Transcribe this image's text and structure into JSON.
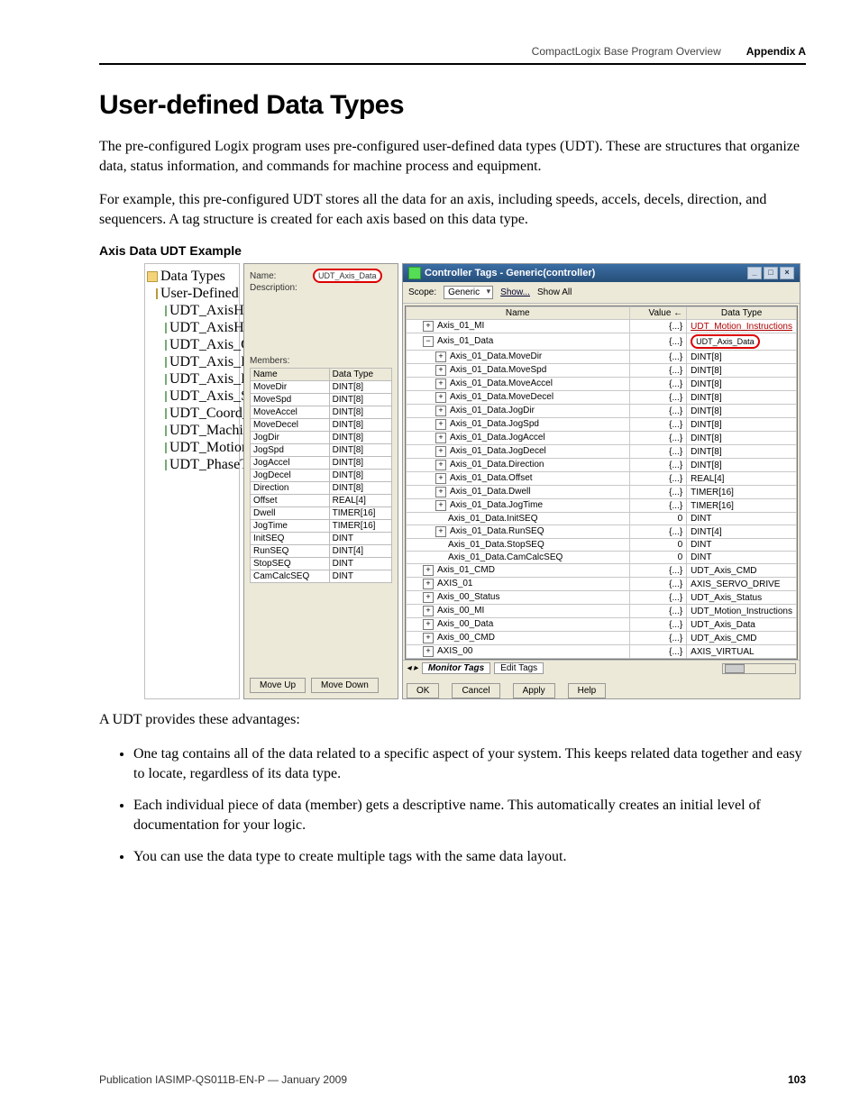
{
  "header": {
    "doc_section": "CompactLogix Base Program Overview",
    "appendix": "Appendix A"
  },
  "title": "User-defined Data Types",
  "para1": "The pre-configured Logix program uses pre-configured user-defined data types (UDT). These are structures that organize data, status information, and commands for machine process and equipment.",
  "para2": "For example, this pre-configured UDT stores all the data for an axis, including speeds, accels, decels, direction, and sequencers. A tag structure is created for each axis based on this data type.",
  "example_title": "Axis Data UDT Example",
  "tree": {
    "root": "Data Types",
    "folder": "User-Defined",
    "items": [
      "UDT_AxisHistory_CTRL",
      "UDT_AxisHistory_DLM",
      "UDT_Axis_CMD",
      "UDT_Axis_Data",
      "UDT_Axis_Hc",
      "UDT_Axis_St",
      "UDT_Coord_I",
      "UDT_Machine",
      "UDT_Motion_",
      "UDT_PhaseTi"
    ]
  },
  "def_dialog": {
    "name_label": "Name:",
    "name_value": "UDT_Axis_Data",
    "desc_label": "Description:",
    "members_label": "Members:",
    "cols": {
      "name": "Name",
      "type": "Data Type"
    },
    "rows": [
      {
        "name": "MoveDir",
        "type": "DINT[8]"
      },
      {
        "name": "MoveSpd",
        "type": "DINT[8]"
      },
      {
        "name": "MoveAccel",
        "type": "DINT[8]"
      },
      {
        "name": "MoveDecel",
        "type": "DINT[8]"
      },
      {
        "name": "JogDir",
        "type": "DINT[8]"
      },
      {
        "name": "JogSpd",
        "type": "DINT[8]"
      },
      {
        "name": "JogAccel",
        "type": "DINT[8]"
      },
      {
        "name": "JogDecel",
        "type": "DINT[8]"
      },
      {
        "name": "Direction",
        "type": "DINT[8]"
      },
      {
        "name": "Offset",
        "type": "REAL[4]"
      },
      {
        "name": "Dwell",
        "type": "TIMER[16]"
      },
      {
        "name": "JogTime",
        "type": "TIMER[16]"
      },
      {
        "name": "InitSEQ",
        "type": "DINT"
      },
      {
        "name": "RunSEQ",
        "type": "DINT[4]"
      },
      {
        "name": "StopSEQ",
        "type": "DINT"
      },
      {
        "name": "CamCalcSEQ",
        "type": "DINT"
      }
    ],
    "btn_moveup": "Move Up",
    "btn_movedown": "Move Down"
  },
  "tags_window": {
    "title": "Controller Tags - Generic(controller)",
    "scope_label": "Scope:",
    "scope_value": "Generic",
    "show_link": "Show...",
    "show_all": "Show All",
    "cols": {
      "name": "Name",
      "value": "Value",
      "type": "Data Type"
    },
    "rows": [
      {
        "ind": 1,
        "exp": "+",
        "name": "Axis_01_MI",
        "value": "{...}",
        "type": "UDT_Motion_Instructions",
        "hl": true
      },
      {
        "ind": 1,
        "exp": "−",
        "name": "Axis_01_Data",
        "value": "{...}",
        "type": "UDT_Axis_Data",
        "hl_type": true
      },
      {
        "ind": 2,
        "exp": "+",
        "name": "Axis_01_Data.MoveDir",
        "value": "{...}",
        "type": "DINT[8]"
      },
      {
        "ind": 2,
        "exp": "+",
        "name": "Axis_01_Data.MoveSpd",
        "value": "{...}",
        "type": "DINT[8]"
      },
      {
        "ind": 2,
        "exp": "+",
        "name": "Axis_01_Data.MoveAccel",
        "value": "{...}",
        "type": "DINT[8]"
      },
      {
        "ind": 2,
        "exp": "+",
        "name": "Axis_01_Data.MoveDecel",
        "value": "{...}",
        "type": "DINT[8]"
      },
      {
        "ind": 2,
        "exp": "+",
        "name": "Axis_01_Data.JogDir",
        "value": "{...}",
        "type": "DINT[8]"
      },
      {
        "ind": 2,
        "exp": "+",
        "name": "Axis_01_Data.JogSpd",
        "value": "{...}",
        "type": "DINT[8]"
      },
      {
        "ind": 2,
        "exp": "+",
        "name": "Axis_01_Data.JogAccel",
        "value": "{...}",
        "type": "DINT[8]"
      },
      {
        "ind": 2,
        "exp": "+",
        "name": "Axis_01_Data.JogDecel",
        "value": "{...}",
        "type": "DINT[8]"
      },
      {
        "ind": 2,
        "exp": "+",
        "name": "Axis_01_Data.Direction",
        "value": "{...}",
        "type": "DINT[8]"
      },
      {
        "ind": 2,
        "exp": "+",
        "name": "Axis_01_Data.Offset",
        "value": "{...}",
        "type": "REAL[4]"
      },
      {
        "ind": 2,
        "exp": "+",
        "name": "Axis_01_Data.Dwell",
        "value": "{...}",
        "type": "TIMER[16]"
      },
      {
        "ind": 2,
        "exp": "+",
        "name": "Axis_01_Data.JogTime",
        "value": "{...}",
        "type": "TIMER[16]"
      },
      {
        "ind": 2,
        "exp": "",
        "name": "Axis_01_Data.InitSEQ",
        "value": "0",
        "type": "DINT"
      },
      {
        "ind": 2,
        "exp": "+",
        "name": "Axis_01_Data.RunSEQ",
        "value": "{...}",
        "type": "DINT[4]"
      },
      {
        "ind": 2,
        "exp": "",
        "name": "Axis_01_Data.StopSEQ",
        "value": "0",
        "type": "DINT"
      },
      {
        "ind": 2,
        "exp": "",
        "name": "Axis_01_Data.CamCalcSEQ",
        "value": "0",
        "type": "DINT"
      },
      {
        "ind": 1,
        "exp": "+",
        "name": "Axis_01_CMD",
        "value": "{...}",
        "type": "UDT_Axis_CMD"
      },
      {
        "ind": 1,
        "exp": "+",
        "name": "AXIS_01",
        "value": "{...}",
        "type": "AXIS_SERVO_DRIVE"
      },
      {
        "ind": 1,
        "exp": "+",
        "name": "Axis_00_Status",
        "value": "{...}",
        "type": "UDT_Axis_Status"
      },
      {
        "ind": 1,
        "exp": "+",
        "name": "Axis_00_MI",
        "value": "{...}",
        "type": "UDT_Motion_Instructions"
      },
      {
        "ind": 1,
        "exp": "+",
        "name": "Axis_00_Data",
        "value": "{...}",
        "type": "UDT_Axis_Data"
      },
      {
        "ind": 1,
        "exp": "+",
        "name": "Axis_00_CMD",
        "value": "{...}",
        "type": "UDT_Axis_CMD"
      },
      {
        "ind": 1,
        "exp": "+",
        "name": "AXIS_00",
        "value": "{...}",
        "type": "AXIS_VIRTUAL"
      }
    ],
    "tab_monitor": "Monitor Tags",
    "tab_edit": "Edit Tags",
    "btn_ok": "OK",
    "btn_cancel": "Cancel",
    "btn_apply": "Apply",
    "btn_help": "Help"
  },
  "advantages_intro": "A UDT provides these advantages:",
  "advantages": [
    "One tag contains all of the data related to a specific aspect of your system. This keeps related data together and easy to locate, regardless of its data type.",
    "Each individual piece of data (member) gets a descriptive name. This automatically creates an initial level of documentation for your logic.",
    "You can use the data type to create multiple tags with the same data layout."
  ],
  "footer": {
    "pub": "Publication IASIMP-QS011B-EN-P — January 2009",
    "page": "103"
  }
}
